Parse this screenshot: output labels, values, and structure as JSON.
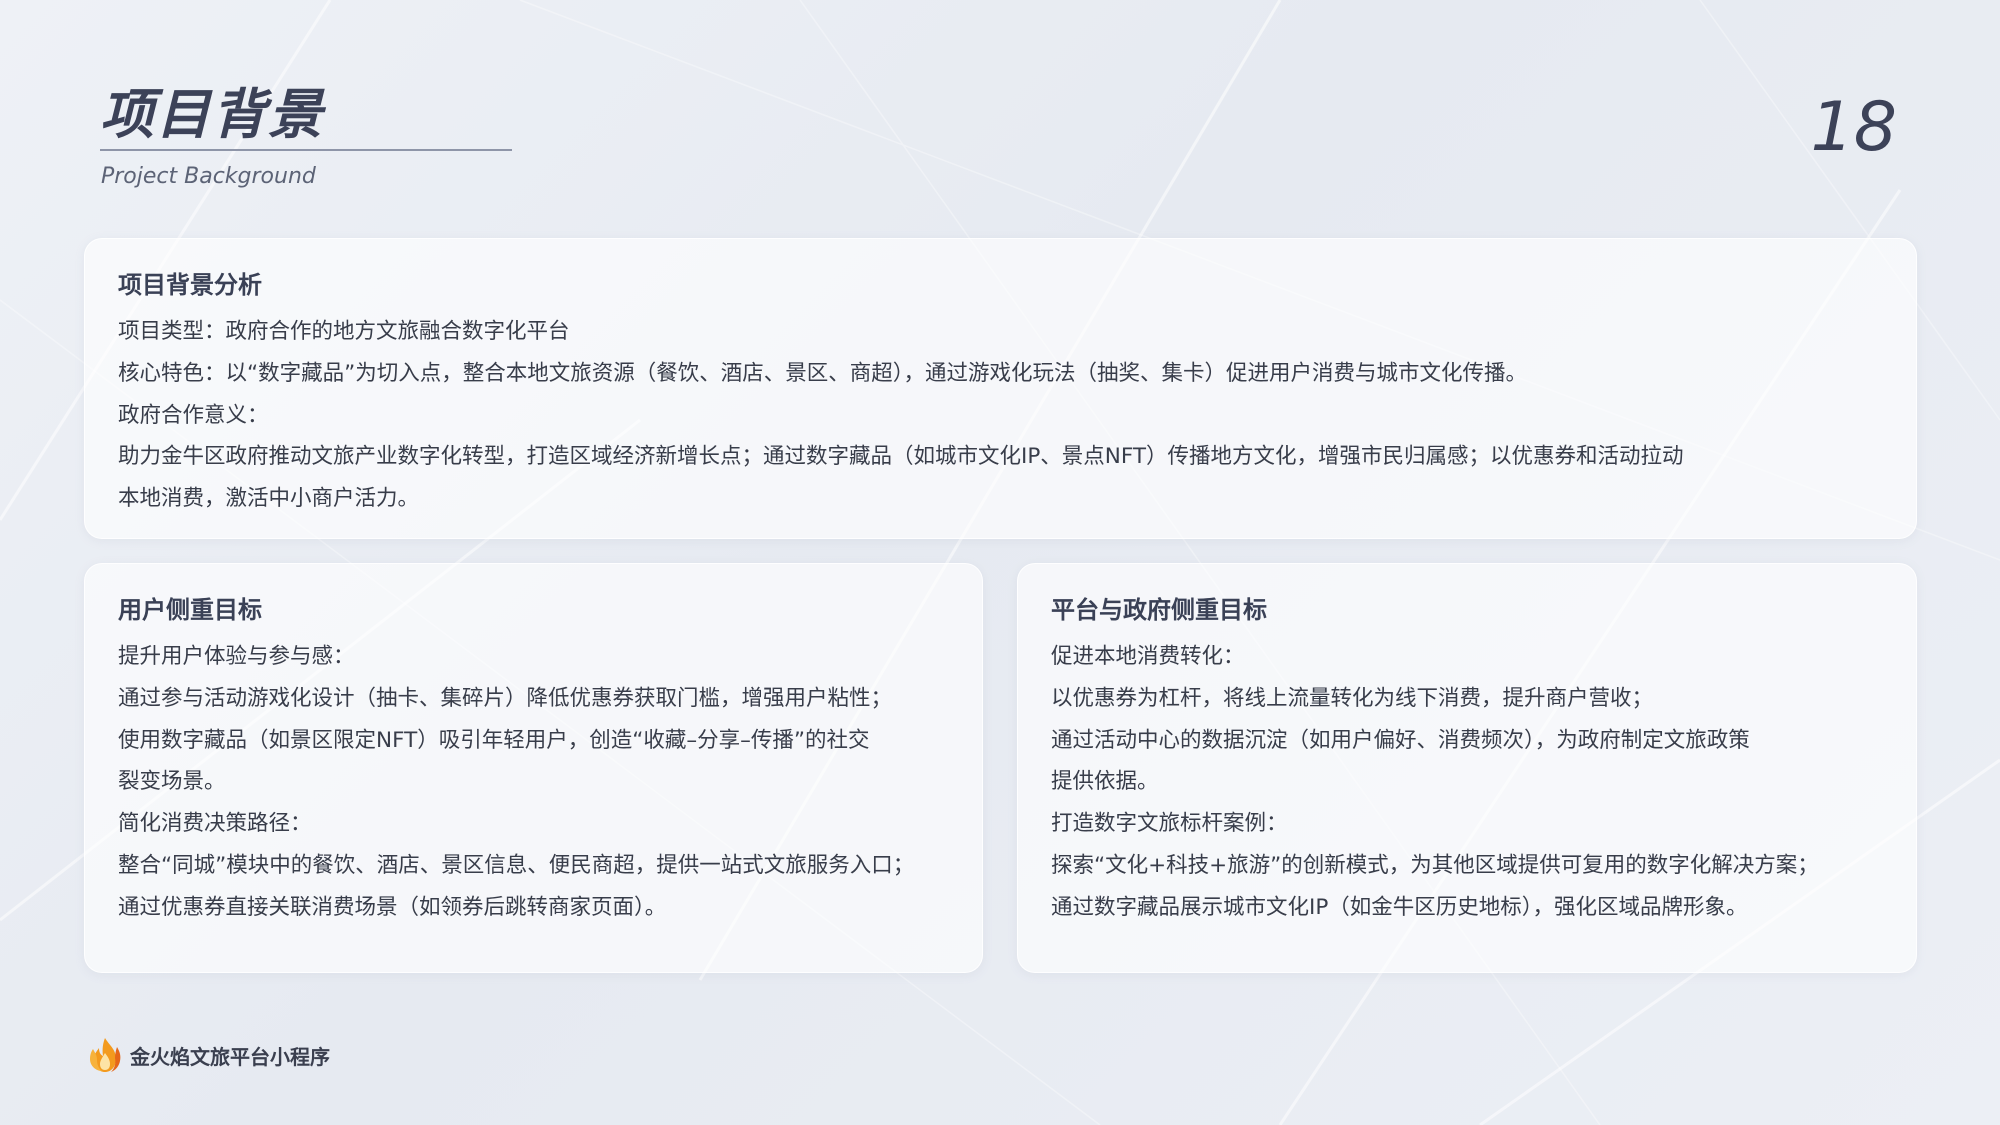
{
  "header": {
    "title": "项目背景",
    "subtitle": "Project Background",
    "page_number": "18"
  },
  "background_section": {
    "heading": "项目背景分析",
    "lines": [
      "项目类型：政府合作的地方文旅融合数字化平台",
      "核心特色：以“数字藏品”为切入点，整合本地文旅资源（餐饮、酒店、景区、商超），通过游戏化玩法（抽奖、集卡）促进用户消费与城市文化传播。",
      "政府合作意义：",
      "助力金牛区政府推动文旅产业数字化转型，打造区域经济新增长点；通过数字藏品（如城市文化IP、景点NFT）传播地方文化，增强市民归属感；以优惠券和活动拉动",
      "本地消费，激活中小商户活力。"
    ]
  },
  "user_goals": {
    "heading": "用户侧重目标",
    "lines": [
      "提升用户体验与参与感：",
      "通过参与活动游戏化设计（抽卡、集碎片）降低优惠券获取门槛，增强用户粘性；",
      "使用数字藏品（如景区限定NFT）吸引年轻用户，创造“收藏–分享–传播”的社交",
      "裂变场景。",
      "简化消费决策路径：",
      "整合“同城”模块中的餐饮、酒店、景区信息、便民商超，提供一站式文旅服务入口；",
      "通过优惠券直接关联消费场景（如领券后跳转商家页面）。"
    ]
  },
  "platform_goals": {
    "heading": "平台与政府侧重目标",
    "lines": [
      "促进本地消费转化：",
      "以优惠券为杠杆，将线上流量转化为线下消费，提升商户营收；",
      "通过活动中心的数据沉淀（如用户偏好、消费频次），为政府制定文旅政策",
      "提供依据。",
      "打造数字文旅标杆案例：",
      "探索“文化+科技+旅游”的创新模式，为其他区域提供可复用的数字化解决方案；",
      "通过数字藏品展示城市文化IP（如金牛区历史地标），强化区域品牌形象。"
    ]
  },
  "footer": {
    "brand": "金火焰文旅平台小程序",
    "logo_icon": "flame-logo-icon"
  },
  "colors": {
    "title": "#3c4258",
    "text": "#383d4a",
    "accent_flame": "#f39a1e",
    "background": "#e9edf3"
  }
}
